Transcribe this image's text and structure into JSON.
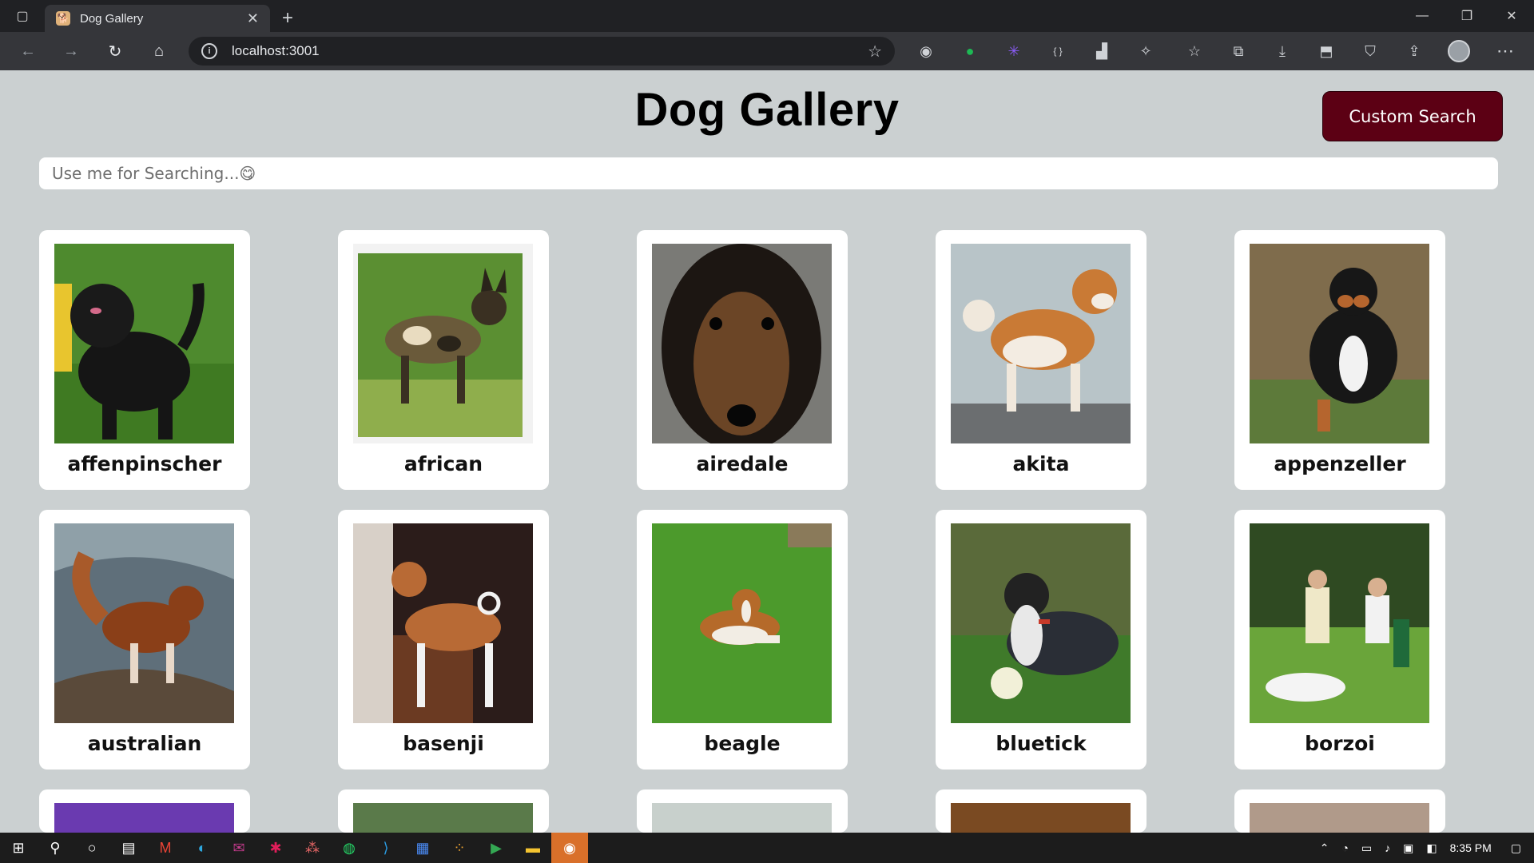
{
  "browser": {
    "tab_title": "Dog Gallery",
    "url": "localhost:3001"
  },
  "page": {
    "title": "Dog Gallery",
    "custom_search_label": "Custom Search",
    "search_placeholder": "Use me for Searching...😋"
  },
  "breeds": [
    {
      "name": "affenpinscher"
    },
    {
      "name": "african"
    },
    {
      "name": "airedale"
    },
    {
      "name": "akita"
    },
    {
      "name": "appenzeller"
    },
    {
      "name": "australian"
    },
    {
      "name": "basenji"
    },
    {
      "name": "beagle"
    },
    {
      "name": "bluetick"
    },
    {
      "name": "borzoi"
    }
  ],
  "taskbar": {
    "time": "8:35 PM"
  },
  "colors": {
    "accent_button": "#5c0014",
    "page_background": "#cbd0d1"
  }
}
